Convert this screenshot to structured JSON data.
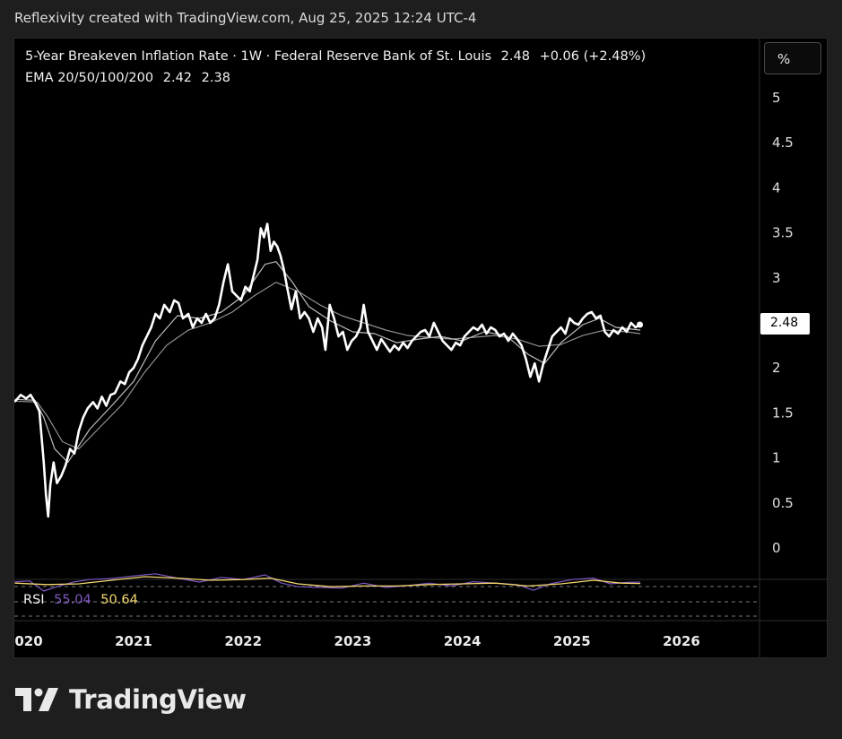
{
  "header": {
    "caption": "Reflexivity created with TradingView.com, Aug 25, 2025 12:24 UTC-4"
  },
  "legend": {
    "title": "5-Year Breakeven Inflation Rate · 1W · Federal Reserve Bank of St. Louis",
    "last_value": "2.48",
    "change": "+0.06 (+2.48%)",
    "ema_label": "EMA 20/50/100/200",
    "ema_value_1": "2.42",
    "ema_value_2": "2.38"
  },
  "unit_button": {
    "label": "%"
  },
  "price_tag": {
    "label": "2.48"
  },
  "rsi": {
    "label": "RSI",
    "value_1": "55.04",
    "value_2": "50.64"
  },
  "logo": {
    "text": "TradingView"
  },
  "colors": {
    "background": "#000000",
    "price_line": "#ffffff",
    "ema_line": "#bdbdbd",
    "rsi_line": "#7e57c2",
    "rsi_ma_line": "#f5d76e",
    "rsi_band": "#7a7a7a"
  },
  "chart_data": {
    "type": "line",
    "title": "5-Year Breakeven Inflation Rate",
    "y_ticks": [
      "5",
      "4.5",
      "4",
      "3.5",
      "3",
      "2.5",
      "2",
      "1.5",
      "1",
      "0.5",
      "0"
    ],
    "x_ticks": [
      "2020",
      "2021",
      "2022",
      "2023",
      "2024",
      "2025",
      "2026"
    ],
    "ylim": [
      0,
      5
    ],
    "series": [
      {
        "name": "5-Year Breakeven Inflation Rate",
        "points": [
          [
            2019.92,
            1.63
          ],
          [
            2019.97,
            1.7
          ],
          [
            2020.02,
            1.66
          ],
          [
            2020.06,
            1.7
          ],
          [
            2020.1,
            1.62
          ],
          [
            2020.14,
            1.52
          ],
          [
            2020.18,
            0.95
          ],
          [
            2020.2,
            0.6
          ],
          [
            2020.22,
            0.35
          ],
          [
            2020.24,
            0.7
          ],
          [
            2020.27,
            0.95
          ],
          [
            2020.3,
            0.72
          ],
          [
            2020.34,
            0.8
          ],
          [
            2020.38,
            0.92
          ],
          [
            2020.42,
            1.1
          ],
          [
            2020.46,
            1.05
          ],
          [
            2020.5,
            1.3
          ],
          [
            2020.54,
            1.45
          ],
          [
            2020.58,
            1.55
          ],
          [
            2020.63,
            1.62
          ],
          [
            2020.67,
            1.55
          ],
          [
            2020.71,
            1.68
          ],
          [
            2020.75,
            1.58
          ],
          [
            2020.79,
            1.7
          ],
          [
            2020.83,
            1.72
          ],
          [
            2020.88,
            1.85
          ],
          [
            2020.92,
            1.82
          ],
          [
            2020.96,
            1.95
          ],
          [
            2021.0,
            2.0
          ],
          [
            2021.04,
            2.1
          ],
          [
            2021.08,
            2.25
          ],
          [
            2021.12,
            2.35
          ],
          [
            2021.16,
            2.45
          ],
          [
            2021.2,
            2.6
          ],
          [
            2021.24,
            2.55
          ],
          [
            2021.28,
            2.7
          ],
          [
            2021.33,
            2.62
          ],
          [
            2021.37,
            2.75
          ],
          [
            2021.41,
            2.72
          ],
          [
            2021.45,
            2.55
          ],
          [
            2021.5,
            2.6
          ],
          [
            2021.54,
            2.45
          ],
          [
            2021.58,
            2.55
          ],
          [
            2021.62,
            2.5
          ],
          [
            2021.66,
            2.6
          ],
          [
            2021.7,
            2.5
          ],
          [
            2021.74,
            2.55
          ],
          [
            2021.78,
            2.7
          ],
          [
            2021.82,
            2.95
          ],
          [
            2021.86,
            3.15
          ],
          [
            2021.9,
            2.85
          ],
          [
            2021.94,
            2.8
          ],
          [
            2021.98,
            2.75
          ],
          [
            2022.02,
            2.9
          ],
          [
            2022.06,
            2.85
          ],
          [
            2022.1,
            3.05
          ],
          [
            2022.13,
            3.2
          ],
          [
            2022.16,
            3.55
          ],
          [
            2022.19,
            3.45
          ],
          [
            2022.22,
            3.6
          ],
          [
            2022.25,
            3.3
          ],
          [
            2022.28,
            3.4
          ],
          [
            2022.31,
            3.35
          ],
          [
            2022.34,
            3.25
          ],
          [
            2022.37,
            3.1
          ],
          [
            2022.4,
            2.9
          ],
          [
            2022.44,
            2.65
          ],
          [
            2022.48,
            2.85
          ],
          [
            2022.52,
            2.55
          ],
          [
            2022.56,
            2.62
          ],
          [
            2022.6,
            2.55
          ],
          [
            2022.64,
            2.4
          ],
          [
            2022.68,
            2.55
          ],
          [
            2022.72,
            2.45
          ],
          [
            2022.75,
            2.2
          ],
          [
            2022.79,
            2.7
          ],
          [
            2022.83,
            2.55
          ],
          [
            2022.87,
            2.35
          ],
          [
            2022.91,
            2.4
          ],
          [
            2022.95,
            2.2
          ],
          [
            2022.99,
            2.3
          ],
          [
            2023.03,
            2.35
          ],
          [
            2023.07,
            2.45
          ],
          [
            2023.1,
            2.7
          ],
          [
            2023.14,
            2.4
          ],
          [
            2023.18,
            2.3
          ],
          [
            2023.22,
            2.2
          ],
          [
            2023.26,
            2.32
          ],
          [
            2023.3,
            2.25
          ],
          [
            2023.34,
            2.18
          ],
          [
            2023.38,
            2.25
          ],
          [
            2023.42,
            2.2
          ],
          [
            2023.46,
            2.28
          ],
          [
            2023.5,
            2.22
          ],
          [
            2023.54,
            2.3
          ],
          [
            2023.58,
            2.35
          ],
          [
            2023.62,
            2.4
          ],
          [
            2023.66,
            2.42
          ],
          [
            2023.7,
            2.35
          ],
          [
            2023.74,
            2.5
          ],
          [
            2023.78,
            2.4
          ],
          [
            2023.82,
            2.3
          ],
          [
            2023.86,
            2.25
          ],
          [
            2023.9,
            2.2
          ],
          [
            2023.94,
            2.28
          ],
          [
            2023.98,
            2.25
          ],
          [
            2024.02,
            2.35
          ],
          [
            2024.06,
            2.4
          ],
          [
            2024.1,
            2.45
          ],
          [
            2024.14,
            2.42
          ],
          [
            2024.18,
            2.48
          ],
          [
            2024.22,
            2.38
          ],
          [
            2024.26,
            2.45
          ],
          [
            2024.3,
            2.42
          ],
          [
            2024.34,
            2.35
          ],
          [
            2024.38,
            2.38
          ],
          [
            2024.42,
            2.3
          ],
          [
            2024.46,
            2.38
          ],
          [
            2024.5,
            2.32
          ],
          [
            2024.54,
            2.25
          ],
          [
            2024.58,
            2.1
          ],
          [
            2024.62,
            1.9
          ],
          [
            2024.66,
            2.05
          ],
          [
            2024.7,
            1.85
          ],
          [
            2024.74,
            2.05
          ],
          [
            2024.78,
            2.2
          ],
          [
            2024.82,
            2.35
          ],
          [
            2024.86,
            2.4
          ],
          [
            2024.9,
            2.45
          ],
          [
            2024.94,
            2.38
          ],
          [
            2024.98,
            2.55
          ],
          [
            2025.02,
            2.5
          ],
          [
            2025.06,
            2.48
          ],
          [
            2025.1,
            2.55
          ],
          [
            2025.14,
            2.6
          ],
          [
            2025.18,
            2.62
          ],
          [
            2025.22,
            2.55
          ],
          [
            2025.26,
            2.58
          ],
          [
            2025.3,
            2.4
          ],
          [
            2025.34,
            2.35
          ],
          [
            2025.38,
            2.42
          ],
          [
            2025.42,
            2.38
          ],
          [
            2025.46,
            2.45
          ],
          [
            2025.5,
            2.4
          ],
          [
            2025.54,
            2.5
          ],
          [
            2025.58,
            2.45
          ],
          [
            2025.62,
            2.48
          ]
        ]
      },
      {
        "name": "EMA 20",
        "points": [
          [
            2019.92,
            1.65
          ],
          [
            2020.1,
            1.64
          ],
          [
            2020.18,
            1.45
          ],
          [
            2020.28,
            1.1
          ],
          [
            2020.4,
            0.95
          ],
          [
            2020.6,
            1.32
          ],
          [
            2020.8,
            1.58
          ],
          [
            2021.0,
            1.85
          ],
          [
            2021.2,
            2.3
          ],
          [
            2021.4,
            2.58
          ],
          [
            2021.6,
            2.55
          ],
          [
            2021.8,
            2.62
          ],
          [
            2022.0,
            2.8
          ],
          [
            2022.2,
            3.15
          ],
          [
            2022.3,
            3.18
          ],
          [
            2022.45,
            2.95
          ],
          [
            2022.6,
            2.68
          ],
          [
            2022.8,
            2.52
          ],
          [
            2023.0,
            2.4
          ],
          [
            2023.2,
            2.38
          ],
          [
            2023.4,
            2.28
          ],
          [
            2023.6,
            2.32
          ],
          [
            2023.8,
            2.35
          ],
          [
            2024.0,
            2.3
          ],
          [
            2024.2,
            2.4
          ],
          [
            2024.4,
            2.36
          ],
          [
            2024.6,
            2.15
          ],
          [
            2024.75,
            2.05
          ],
          [
            2024.9,
            2.28
          ],
          [
            2025.1,
            2.48
          ],
          [
            2025.25,
            2.55
          ],
          [
            2025.4,
            2.45
          ],
          [
            2025.62,
            2.42
          ]
        ]
      },
      {
        "name": "EMA 50",
        "points": [
          [
            2019.92,
            1.63
          ],
          [
            2020.12,
            1.62
          ],
          [
            2020.22,
            1.45
          ],
          [
            2020.35,
            1.18
          ],
          [
            2020.5,
            1.1
          ],
          [
            2020.7,
            1.35
          ],
          [
            2020.9,
            1.6
          ],
          [
            2021.1,
            1.95
          ],
          [
            2021.3,
            2.25
          ],
          [
            2021.5,
            2.42
          ],
          [
            2021.7,
            2.5
          ],
          [
            2021.9,
            2.62
          ],
          [
            2022.1,
            2.8
          ],
          [
            2022.3,
            2.95
          ],
          [
            2022.5,
            2.85
          ],
          [
            2022.7,
            2.7
          ],
          [
            2022.9,
            2.58
          ],
          [
            2023.1,
            2.5
          ],
          [
            2023.3,
            2.42
          ],
          [
            2023.5,
            2.36
          ],
          [
            2023.7,
            2.34
          ],
          [
            2023.9,
            2.32
          ],
          [
            2024.1,
            2.34
          ],
          [
            2024.3,
            2.36
          ],
          [
            2024.5,
            2.32
          ],
          [
            2024.7,
            2.24
          ],
          [
            2024.9,
            2.26
          ],
          [
            2025.1,
            2.36
          ],
          [
            2025.3,
            2.42
          ],
          [
            2025.5,
            2.4
          ],
          [
            2025.62,
            2.38
          ]
        ]
      },
      {
        "name": "RSI",
        "points": [
          [
            2019.92,
            0.56
          ],
          [
            2020.05,
            0.58
          ],
          [
            2020.18,
            0.3
          ],
          [
            2020.3,
            0.42
          ],
          [
            2020.45,
            0.55
          ],
          [
            2020.6,
            0.62
          ],
          [
            2020.8,
            0.65
          ],
          [
            2021.0,
            0.72
          ],
          [
            2021.2,
            0.78
          ],
          [
            2021.4,
            0.66
          ],
          [
            2021.6,
            0.55
          ],
          [
            2021.8,
            0.68
          ],
          [
            2022.0,
            0.62
          ],
          [
            2022.2,
            0.75
          ],
          [
            2022.35,
            0.52
          ],
          [
            2022.5,
            0.42
          ],
          [
            2022.7,
            0.4
          ],
          [
            2022.9,
            0.38
          ],
          [
            2023.1,
            0.52
          ],
          [
            2023.3,
            0.4
          ],
          [
            2023.5,
            0.45
          ],
          [
            2023.7,
            0.52
          ],
          [
            2023.9,
            0.44
          ],
          [
            2024.1,
            0.56
          ],
          [
            2024.3,
            0.52
          ],
          [
            2024.5,
            0.48
          ],
          [
            2024.65,
            0.32
          ],
          [
            2024.8,
            0.5
          ],
          [
            2025.0,
            0.62
          ],
          [
            2025.2,
            0.66
          ],
          [
            2025.35,
            0.5
          ],
          [
            2025.5,
            0.54
          ],
          [
            2025.62,
            0.55
          ]
        ]
      },
      {
        "name": "RSI MA",
        "points": [
          [
            2019.92,
            0.52
          ],
          [
            2020.2,
            0.48
          ],
          [
            2020.5,
            0.5
          ],
          [
            2020.8,
            0.6
          ],
          [
            2021.1,
            0.7
          ],
          [
            2021.4,
            0.66
          ],
          [
            2021.7,
            0.6
          ],
          [
            2022.0,
            0.62
          ],
          [
            2022.25,
            0.66
          ],
          [
            2022.5,
            0.5
          ],
          [
            2022.8,
            0.42
          ],
          [
            2023.1,
            0.44
          ],
          [
            2023.4,
            0.44
          ],
          [
            2023.7,
            0.48
          ],
          [
            2024.0,
            0.5
          ],
          [
            2024.3,
            0.52
          ],
          [
            2024.6,
            0.44
          ],
          [
            2024.9,
            0.5
          ],
          [
            2025.2,
            0.6
          ],
          [
            2025.45,
            0.52
          ],
          [
            2025.62,
            0.51
          ]
        ]
      }
    ]
  }
}
